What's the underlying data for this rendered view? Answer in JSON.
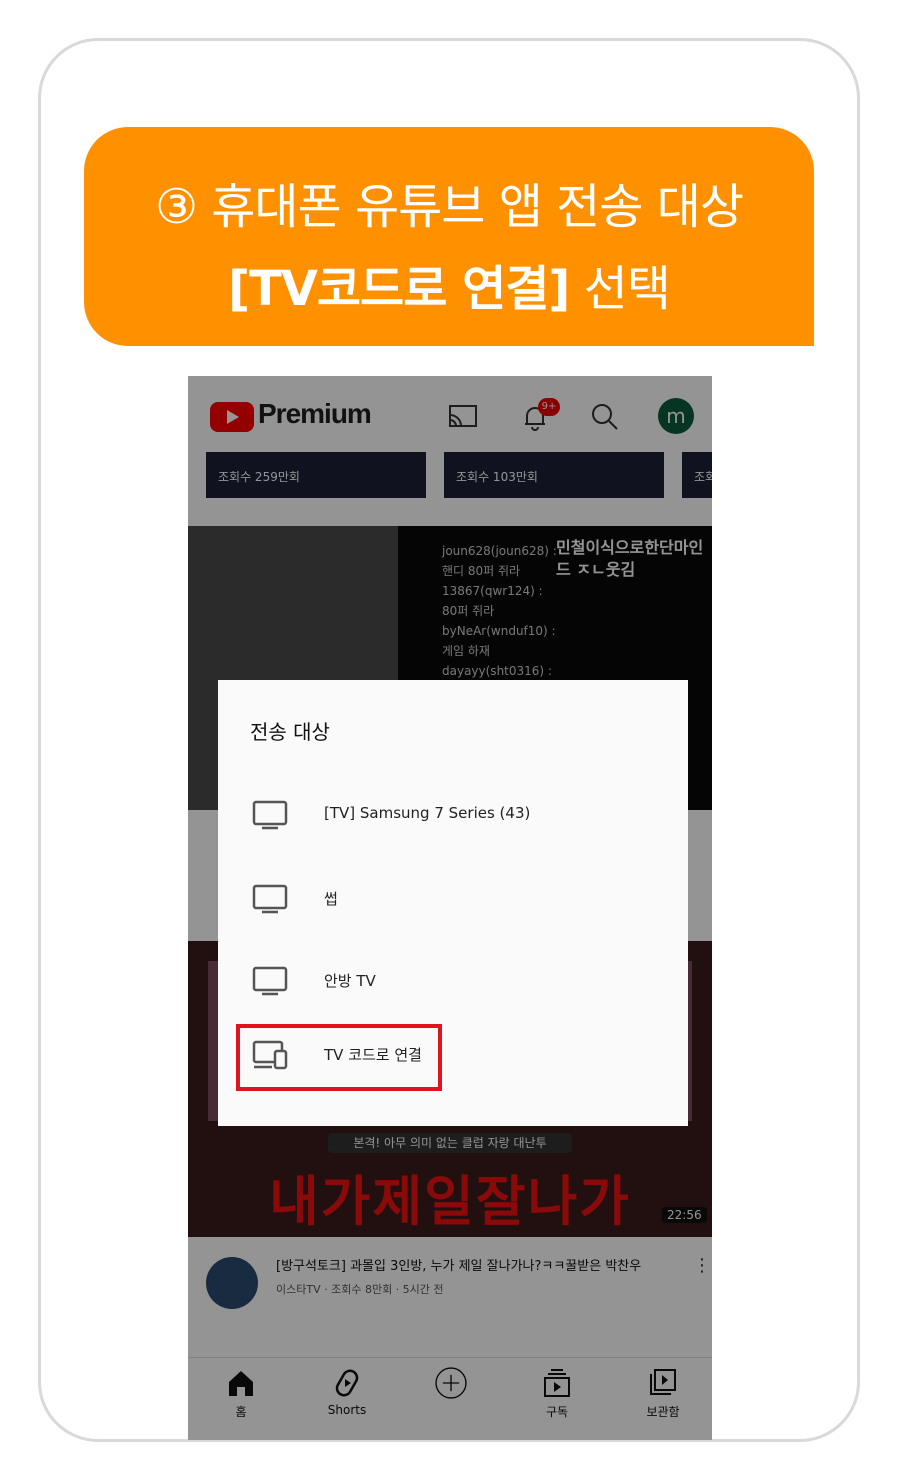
{
  "banner": {
    "line1": "③ 휴대폰 유튜브 앱 전송 대상",
    "line2_bold": "[TV코드로 연결]",
    "line2_rest": " 선택"
  },
  "app": {
    "title": "Premium",
    "notification_badge": "9+",
    "avatar_letter": "m",
    "accent": "#ff0000"
  },
  "feed": {
    "thumb_views": [
      "조회수 259만회",
      "조회수 103만회",
      "조회"
    ],
    "chat_lines": [
      "joun628(joun628) :",
      "핸디 80퍼 쥐라",
      "13867(qwr124) :",
      "80퍼 쥐라",
      "byNeAr(wnduf10) :",
      "게임 하재",
      "dayayy(sht0316) :"
    ],
    "chat_overlay": "민철이식으로한단마인",
    "chat_overlay_2": "드 ㅈㄴ웃김",
    "video2_subtitle": "본격! 아무 의미 없는 클럽 자랑 대난투",
    "video2_title": "내가제일잘나가",
    "video2_duration": "22:56",
    "video2_meta_title": "[방구석토크] 과몰입 3인방, 누가 제일 잘나가나?ㅋㅋ꿀받은 박찬우",
    "video2_meta_sub": "이스타TV · 조회수 8만회 · 5시간 전"
  },
  "dialog": {
    "title": "전송 대상",
    "options": [
      {
        "label": "[TV] Samsung 7 Series (43)",
        "icon": "tv-icon"
      },
      {
        "label": "썹",
        "icon": "tv-icon"
      },
      {
        "label": "안방 TV",
        "icon": "tv-icon"
      },
      {
        "label": "TV 코드로 연결",
        "icon": "devices-icon"
      }
    ],
    "highlight_color": "#e0141e"
  },
  "nav": [
    {
      "label": "홈",
      "icon": "home-icon"
    },
    {
      "label": "Shorts",
      "icon": "shorts-icon"
    },
    {
      "label": "",
      "icon": "add-circle-icon"
    },
    {
      "label": "구독",
      "icon": "subscriptions-icon"
    },
    {
      "label": "보관함",
      "icon": "library-icon"
    }
  ]
}
